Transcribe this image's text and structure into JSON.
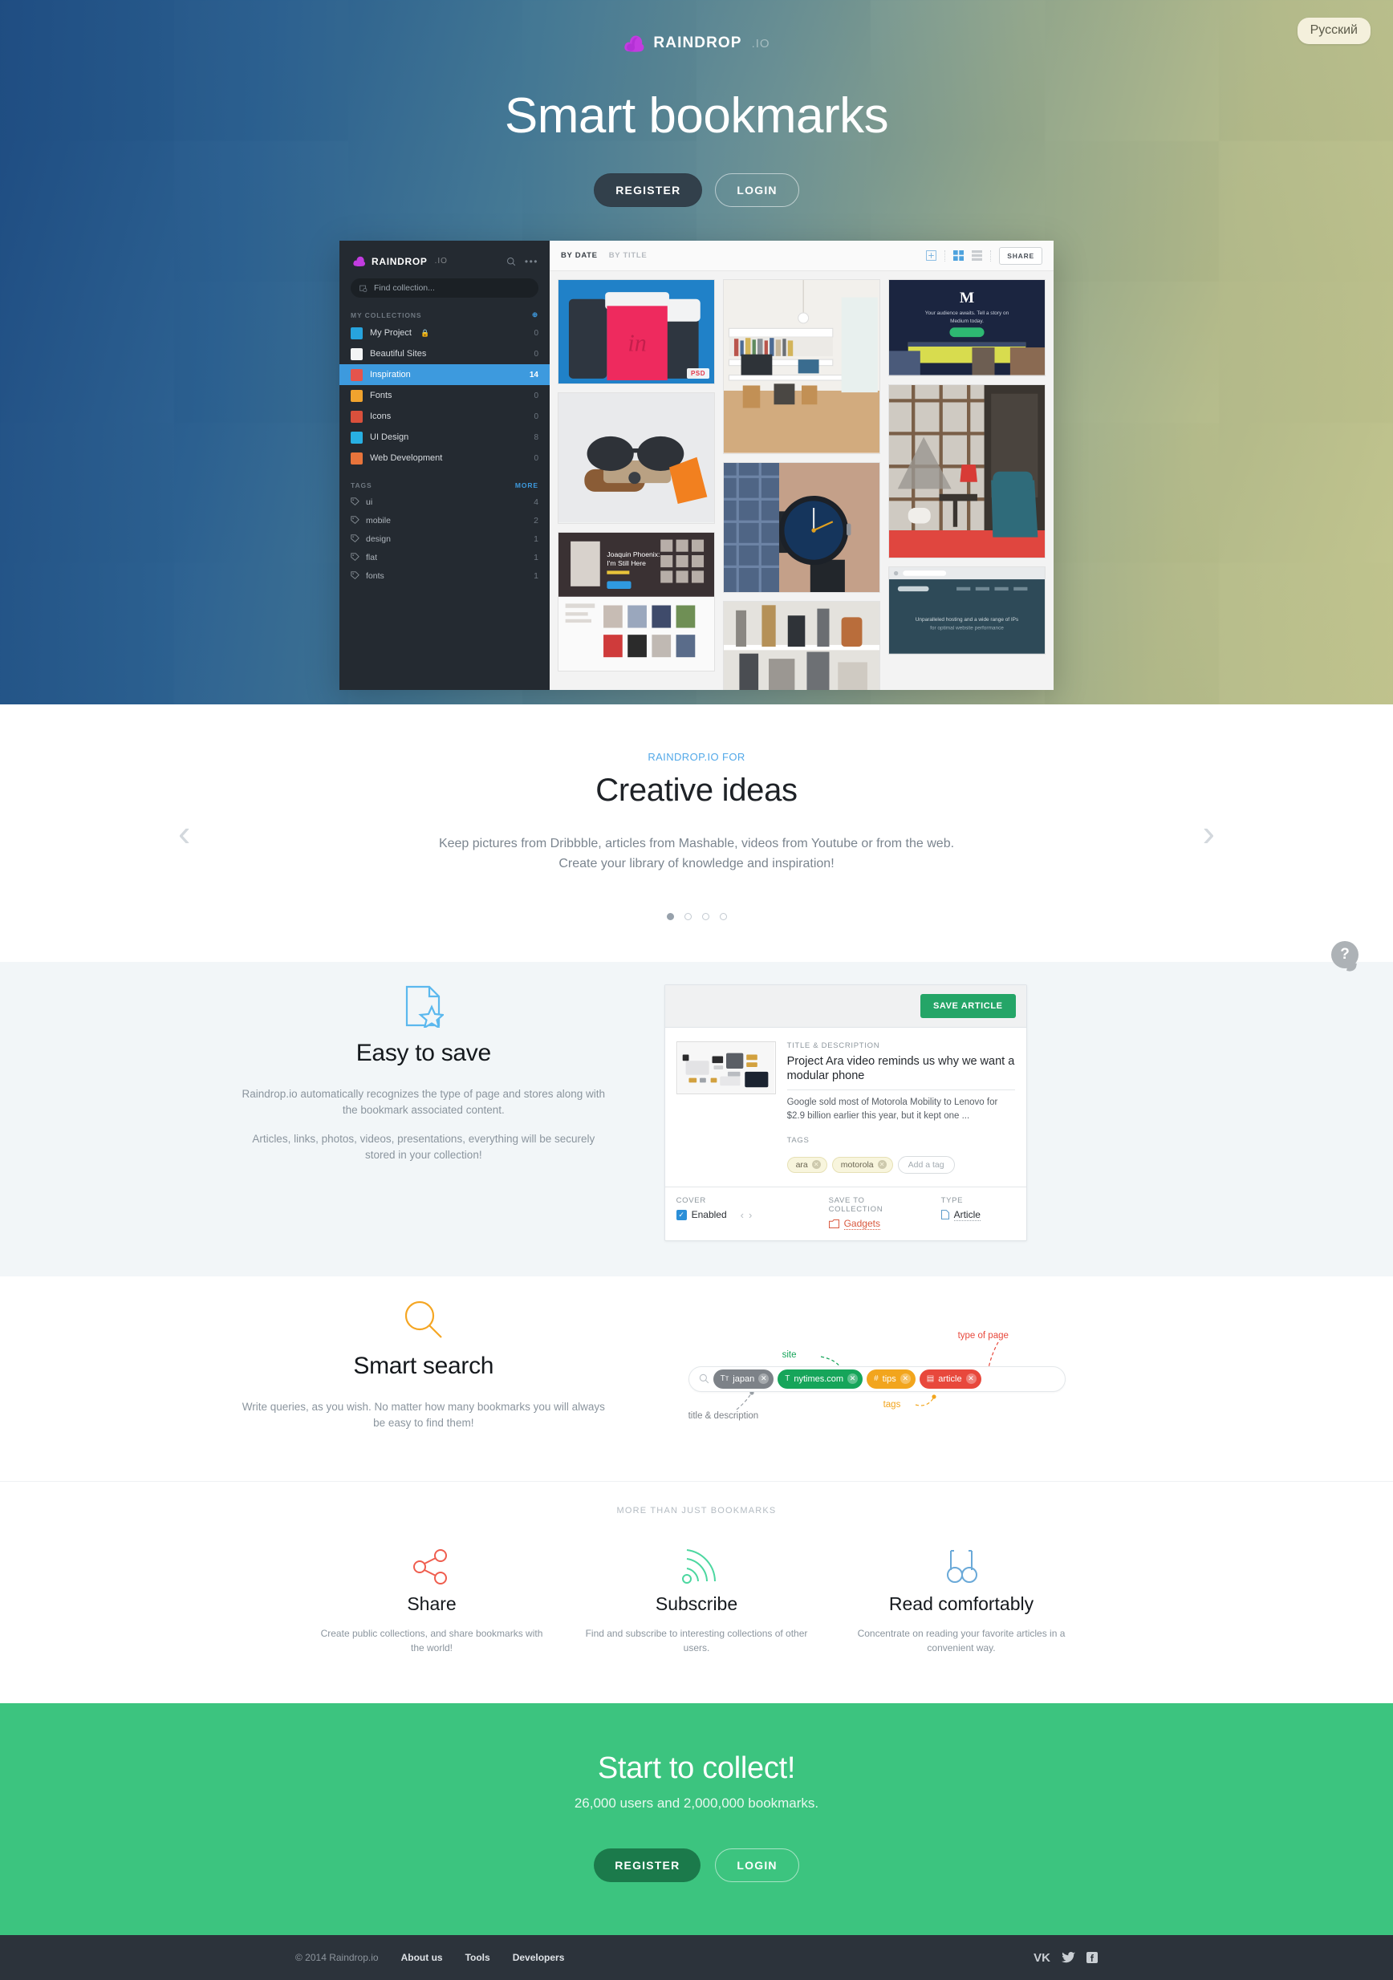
{
  "brand": {
    "name": "RAINDROP",
    "suffix": ".IO",
    "accent_purple": "#c23ce0",
    "accent_blue": "#3d9ade",
    "accent_green": "#3cc47f"
  },
  "hero": {
    "lang_button": "Русский",
    "title": "Smart bookmarks",
    "register_label": "REGISTER",
    "login_label": "LOGIN"
  },
  "app": {
    "logo_name": "RAINDROP",
    "logo_suffix": ".IO",
    "search_placeholder": "Find collection...",
    "collections_header": "MY COLLECTIONS",
    "tags_header": "TAGS",
    "tags_more": "MORE",
    "collections": [
      {
        "label": "My Project",
        "count": "0",
        "color": "#27a3dd",
        "locked": true
      },
      {
        "label": "Beautiful Sites",
        "count": "0",
        "color": "#f3f4f5",
        "locked": false
      },
      {
        "label": "Inspiration",
        "count": "14",
        "color": "#e5544c",
        "locked": false,
        "active": true
      },
      {
        "label": "Fonts",
        "count": "0",
        "color": "#f0a32e",
        "locked": false
      },
      {
        "label": "Icons",
        "count": "0",
        "color": "#d9503c",
        "locked": false
      },
      {
        "label": "UI Design",
        "count": "8",
        "color": "#28b0e3",
        "locked": false
      },
      {
        "label": "Web Development",
        "count": "0",
        "color": "#e8743b",
        "locked": false
      }
    ],
    "tags": [
      {
        "label": "ui",
        "count": "4"
      },
      {
        "label": "mobile",
        "count": "2"
      },
      {
        "label": "design",
        "count": "1"
      },
      {
        "label": "flat",
        "count": "1"
      },
      {
        "label": "fonts",
        "count": "1"
      }
    ],
    "toolbar": {
      "sort_by_date": "BY DATE",
      "sort_by_title": "BY TITLE",
      "share_label": "SHARE"
    },
    "card_badge": "PSD"
  },
  "carousel": {
    "eyebrow": "RAINDROP.IO FOR",
    "title": "Creative ideas",
    "desc_line1": "Keep pictures from Dribbble, articles from Mashable, videos from Youtube or from the web.",
    "desc_line2": "Create your library of knowledge and inspiration!",
    "prev": "‹",
    "next": "›",
    "dots": 4,
    "active_dot": 0
  },
  "help": {
    "glyph": "?"
  },
  "easy_to_save": {
    "title": "Easy to save",
    "p1": "Raindrop.io automatically recognizes the type of page and stores along with the bookmark associated content.",
    "p2": "Articles, links, photos, videos, presentations, everything will be securely stored in your collection!"
  },
  "save_panel": {
    "save_button": "SAVE ARTICLE",
    "title_label": "TITLE & DESCRIPTION",
    "title": "Project Ara video reminds us why we want a modular phone",
    "description": "Google sold most of Motorola Mobility to Lenovo for $2.9 billion earlier this year, but it kept one ...",
    "tags_label": "TAGS",
    "tags": [
      "ara",
      "motorola"
    ],
    "add_tag_placeholder": "Add a tag",
    "cover_label": "COVER",
    "cover_value": "Enabled",
    "collection_label": "SAVE TO COLLECTION",
    "collection_value": "Gadgets",
    "type_label": "TYPE",
    "type_value": "Article"
  },
  "smart_search": {
    "title": "Smart search",
    "p1": "Write queries, as you wish. No matter how many bookmarks you will always be easy to find them!",
    "pills": [
      {
        "glyph": "Tт",
        "label": "japan",
        "color": "#7d8288"
      },
      {
        "glyph": "T",
        "label": "nytimes.com",
        "color": "#16a55a"
      },
      {
        "glyph": "#",
        "label": "tips",
        "color": "#f2a51d"
      },
      {
        "glyph": "▤",
        "label": "article",
        "color": "#e8483c"
      }
    ],
    "annotations": {
      "site": "site",
      "type_of_page": "type of page",
      "title_description": "title & description",
      "tags": "tags"
    }
  },
  "more_than": {
    "eyebrow": "MORE THAN JUST BOOKMARKS",
    "columns": [
      {
        "icon": "share-icon",
        "title": "Share",
        "desc": "Create public collections, and share bookmarks with the world!",
        "color": "#ef5d4e"
      },
      {
        "icon": "subscribe-icon",
        "title": "Subscribe",
        "desc": "Find and subscribe to interesting collections of other users.",
        "color": "#4cd7a0"
      },
      {
        "icon": "glasses-icon",
        "title": "Read comfortably",
        "desc": "Concentrate on reading your favorite articles in a convenient way.",
        "color": "#6aa9d8"
      }
    ]
  },
  "cta": {
    "title": "Start to collect!",
    "subtitle": "26,000 users and 2,000,000 bookmarks.",
    "register_label": "REGISTER",
    "login_label": "LOGIN"
  },
  "footer": {
    "copyright": "© 2014 Raindrop.io",
    "links": [
      "About us",
      "Tools",
      "Developers"
    ],
    "social": [
      "vk-icon",
      "twitter-icon",
      "facebook-icon"
    ]
  }
}
